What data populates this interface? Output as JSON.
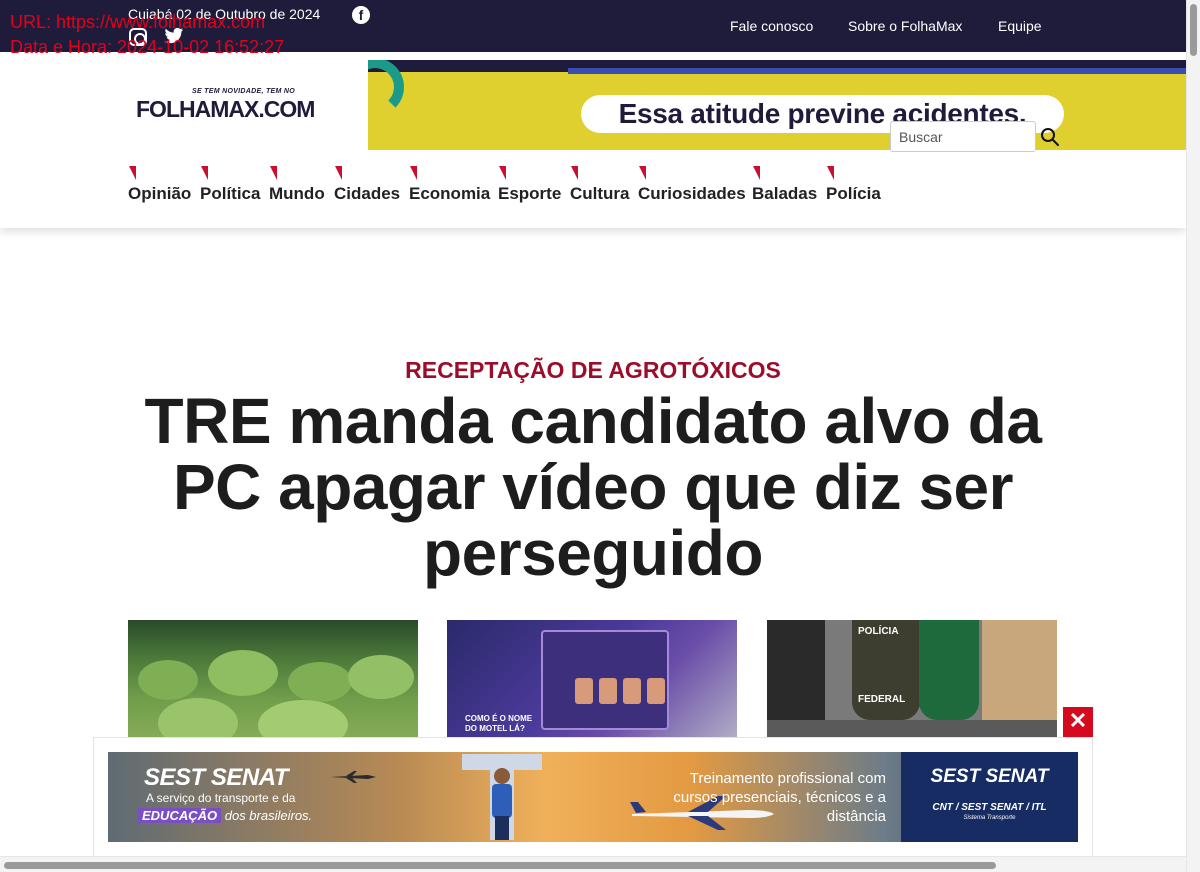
{
  "overlay": {
    "url_line": "URL: https://www.folhamax.com",
    "datetime_line": "Data e Hora: 2024-10-02 16:52:27"
  },
  "topbar": {
    "date": "Cuiabá 02 de Outubro de 2024",
    "social_icons": [
      "facebook-icon",
      "instagram-icon",
      "twitter-icon"
    ],
    "links": [
      "Fale conosco",
      "Sobre o FolhaMax",
      "Equipe"
    ]
  },
  "logo": {
    "tagline": "SE TEM NOVIDADE, TEM NO",
    "word_a": "FOLHA",
    "word_b": "MAX",
    "word_c": ".COM"
  },
  "top_banner": {
    "text": "Essa atitude previne acidentes."
  },
  "nav": {
    "items": [
      "Opinião",
      "Política",
      "Mundo",
      "Cidades",
      "Economia",
      "Esporte",
      "Cultura",
      "Curiosidades",
      "Baladas",
      "Polícia"
    ]
  },
  "search": {
    "placeholder": "Buscar",
    "icon": "search-icon"
  },
  "article": {
    "kicker": "RECEPTAÇÃO DE AGROTÓXICOS",
    "headline": "TRE manda candidato alvo da PC apagar vídeo que diz ser perseguido"
  },
  "thumbnails": {
    "motel_caption": "COMO É O NOME DO MOTEL LÁ?",
    "police_badge": "POLÍCIA",
    "police_badge_2": "FEDERAL"
  },
  "bottom_ad": {
    "brand": "SEST SENAT",
    "tagline_1": "A serviço do transporte e da",
    "tagline_2_highlight": "EDUCAÇÃO",
    "tagline_2_rest": " dos brasileiros.",
    "copy": "Treinamento profissional com cursos presenciais, técnicos e a distância",
    "right_brand": "SEST SENAT",
    "right_sub": "CNT / SEST SENAT / ITL",
    "right_sub2": "Sistema Transporte",
    "close_label": "✕"
  },
  "colors": {
    "topbar_bg": "#1f1b3a",
    "kicker": "#9b0d2a",
    "accent_red": "#c8102e",
    "close_button": "#d60a1e"
  }
}
